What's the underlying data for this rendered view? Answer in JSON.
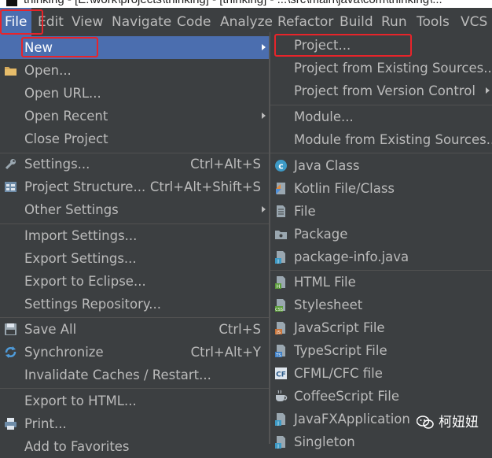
{
  "window": {
    "title": "thinking - [E:\\work\\projects\\thinking] - [thinking] - ...\\src\\main\\java\\com\\thinking\\..."
  },
  "menubar": {
    "items": [
      "File",
      "Edit",
      "View",
      "Navigate",
      "Code",
      "Analyze",
      "Refactor",
      "Build",
      "Run",
      "Tools",
      "VCS"
    ]
  },
  "file_menu": {
    "new": "New",
    "open": "Open...",
    "open_url": "Open URL...",
    "open_recent": "Open Recent",
    "close_project": "Close Project",
    "settings": "Settings...",
    "settings_shortcut": "Ctrl+Alt+S",
    "project_structure": "Project Structure...",
    "project_structure_shortcut": "Ctrl+Alt+Shift+S",
    "other_settings": "Other Settings",
    "import_settings": "Import Settings...",
    "export_settings": "Export Settings...",
    "export_eclipse": "Export to Eclipse...",
    "settings_repository": "Settings Repository...",
    "save_all": "Save All",
    "save_all_shortcut": "Ctrl+S",
    "synchronize": "Synchronize",
    "synchronize_shortcut": "Ctrl+Alt+Y",
    "invalidate_caches": "Invalidate Caches / Restart...",
    "export_html": "Export to HTML...",
    "print": "Print...",
    "add_to_favorites": "Add to Favorites"
  },
  "new_menu": {
    "project": "Project...",
    "project_existing": "Project from Existing Sources...",
    "project_vcs": "Project from Version Control",
    "module": "Module...",
    "module_existing": "Module from Existing Sources...",
    "java_class": "Java Class",
    "kotlin": "Kotlin File/Class",
    "file": "File",
    "package": "Package",
    "package_info": "package-info.java",
    "html_file": "HTML File",
    "stylesheet": "Stylesheet",
    "javascript": "JavaScript File",
    "typescript": "TypeScript File",
    "cfml": "CFML/CFC file",
    "coffeescript": "CoffeeScript File",
    "javafx": "JavaFXApplication",
    "singleton": "Singleton"
  },
  "watermark": {
    "text": "柯妞妞"
  },
  "colors": {
    "background": "#3c3f41",
    "selection": "#4b6eaf",
    "text": "#bbbbbb",
    "highlight_box": "#e8242a"
  }
}
